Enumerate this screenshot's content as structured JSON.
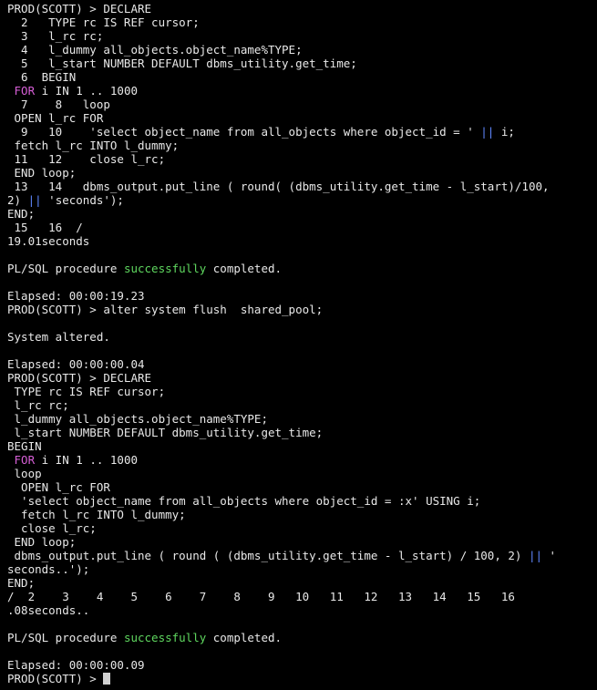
{
  "terminal": {
    "colors": {
      "background": "#000000",
      "text": "#e8e8e8",
      "keyword": "#d75fd7",
      "operator": "#5f87ff",
      "success": "#5fd75f",
      "cursor": "#d0d0d0"
    },
    "lines": [
      [
        {
          "t": "PROD(SCOTT) > DECLARE"
        }
      ],
      [
        {
          "t": "  2   TYPE rc IS REF cursor;"
        }
      ],
      [
        {
          "t": "  3   l_rc rc;"
        }
      ],
      [
        {
          "t": "  4   l_dummy all_objects.object_name%TYPE;"
        }
      ],
      [
        {
          "t": "  5   l_start NUMBER DEFAULT dbms_utility.get_time;"
        }
      ],
      [
        {
          "t": "  6  BEGIN"
        }
      ],
      [
        {
          "t": " "
        },
        {
          "t": "FOR",
          "c": "kw"
        },
        {
          "t": " i IN 1 .. 1000"
        }
      ],
      [
        {
          "t": "  7    8   loop"
        }
      ],
      [
        {
          "t": " OPEN l_rc FOR"
        }
      ],
      [
        {
          "t": "  9   10    'select object_name from all_objects where object_id = ' "
        },
        {
          "t": "||",
          "c": "op"
        },
        {
          "t": " i;"
        }
      ],
      [
        {
          "t": " fetch l_rc INTO l_dummy;"
        }
      ],
      [
        {
          "t": " 11   12    close l_rc;"
        }
      ],
      [
        {
          "t": " END loop;"
        }
      ],
      [
        {
          "t": " 13   14   dbms_output.put_line ( round( (dbms_utility.get_time - l_start)/100,"
        }
      ],
      [
        {
          "t": "2) "
        },
        {
          "t": "||",
          "c": "op"
        },
        {
          "t": " 'seconds');"
        }
      ],
      [
        {
          "t": "END;"
        }
      ],
      [
        {
          "t": " 15   16  /"
        }
      ],
      [
        {
          "t": "19.01seconds"
        }
      ],
      [
        {
          "t": ""
        }
      ],
      [
        {
          "t": "PL/SQL procedure "
        },
        {
          "t": "successfully",
          "c": "ok"
        },
        {
          "t": " completed."
        }
      ],
      [
        {
          "t": ""
        }
      ],
      [
        {
          "t": "Elapsed: 00:00:19.23"
        }
      ],
      [
        {
          "t": "PROD(SCOTT) > alter system flush  shared_pool;"
        }
      ],
      [
        {
          "t": ""
        }
      ],
      [
        {
          "t": "System altered."
        }
      ],
      [
        {
          "t": ""
        }
      ],
      [
        {
          "t": "Elapsed: 00:00:00.04"
        }
      ],
      [
        {
          "t": "PROD(SCOTT) > DECLARE"
        }
      ],
      [
        {
          "t": " TYPE rc IS REF cursor;"
        }
      ],
      [
        {
          "t": " l_rc rc;"
        }
      ],
      [
        {
          "t": " l_dummy all_objects.object_name%TYPE;"
        }
      ],
      [
        {
          "t": " l_start NUMBER DEFAULT dbms_utility.get_time;"
        }
      ],
      [
        {
          "t": "BEGIN"
        }
      ],
      [
        {
          "t": " "
        },
        {
          "t": "FOR",
          "c": "kw"
        },
        {
          "t": " i IN 1 .. 1000"
        }
      ],
      [
        {
          "t": " loop"
        }
      ],
      [
        {
          "t": "  OPEN l_rc FOR"
        }
      ],
      [
        {
          "t": "  'select object_name from all_objects where object_id = :x' USING i;"
        }
      ],
      [
        {
          "t": "  fetch l_rc INTO l_dummy;"
        }
      ],
      [
        {
          "t": "  close l_rc;"
        }
      ],
      [
        {
          "t": " END loop;"
        }
      ],
      [
        {
          "t": " dbms_output.put_line ( round ( (dbms_utility.get_time - l_start) / 100, 2) "
        },
        {
          "t": "||",
          "c": "op"
        },
        {
          "t": " '"
        }
      ],
      [
        {
          "t": "seconds..');"
        }
      ],
      [
        {
          "t": "END;"
        }
      ],
      [
        {
          "t": "/  2    3    4    5    6    7    8    9   10   11   12   13   14   15   16"
        }
      ],
      [
        {
          "t": ".08seconds.."
        }
      ],
      [
        {
          "t": ""
        }
      ],
      [
        {
          "t": "PL/SQL procedure "
        },
        {
          "t": "successfully",
          "c": "ok"
        },
        {
          "t": " completed."
        }
      ],
      [
        {
          "t": ""
        }
      ],
      [
        {
          "t": "Elapsed: 00:00:00.09"
        }
      ]
    ],
    "prompt": "PROD(SCOTT) > ",
    "cursor_icon": "block-cursor-icon"
  }
}
